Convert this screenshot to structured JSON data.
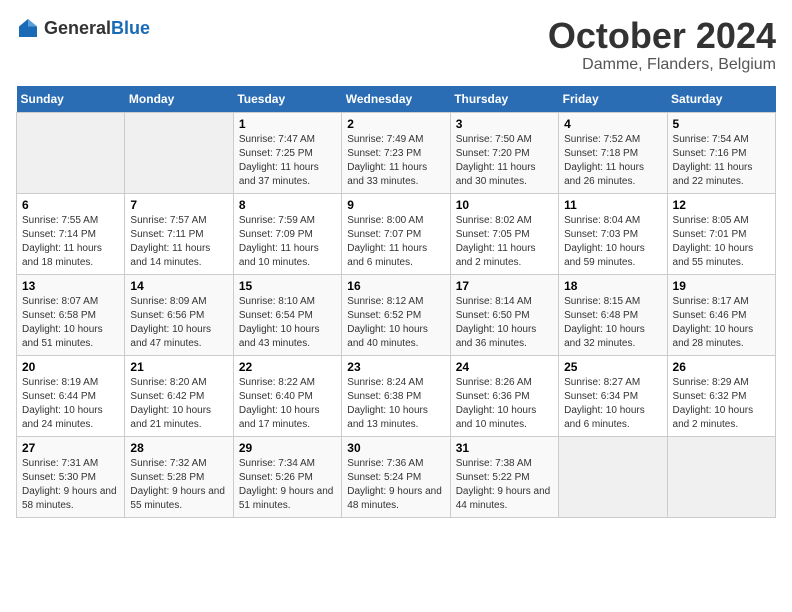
{
  "header": {
    "logo_general": "General",
    "logo_blue": "Blue",
    "title": "October 2024",
    "subtitle": "Damme, Flanders, Belgium"
  },
  "weekdays": [
    "Sunday",
    "Monday",
    "Tuesday",
    "Wednesday",
    "Thursday",
    "Friday",
    "Saturday"
  ],
  "weeks": [
    [
      {
        "day": "",
        "empty": true
      },
      {
        "day": "",
        "empty": true
      },
      {
        "day": "1",
        "sunrise": "7:47 AM",
        "sunset": "7:25 PM",
        "daylight": "11 hours and 37 minutes."
      },
      {
        "day": "2",
        "sunrise": "7:49 AM",
        "sunset": "7:23 PM",
        "daylight": "11 hours and 33 minutes."
      },
      {
        "day": "3",
        "sunrise": "7:50 AM",
        "sunset": "7:20 PM",
        "daylight": "11 hours and 30 minutes."
      },
      {
        "day": "4",
        "sunrise": "7:52 AM",
        "sunset": "7:18 PM",
        "daylight": "11 hours and 26 minutes."
      },
      {
        "day": "5",
        "sunrise": "7:54 AM",
        "sunset": "7:16 PM",
        "daylight": "11 hours and 22 minutes."
      }
    ],
    [
      {
        "day": "6",
        "sunrise": "7:55 AM",
        "sunset": "7:14 PM",
        "daylight": "11 hours and 18 minutes."
      },
      {
        "day": "7",
        "sunrise": "7:57 AM",
        "sunset": "7:11 PM",
        "daylight": "11 hours and 14 minutes."
      },
      {
        "day": "8",
        "sunrise": "7:59 AM",
        "sunset": "7:09 PM",
        "daylight": "11 hours and 10 minutes."
      },
      {
        "day": "9",
        "sunrise": "8:00 AM",
        "sunset": "7:07 PM",
        "daylight": "11 hours and 6 minutes."
      },
      {
        "day": "10",
        "sunrise": "8:02 AM",
        "sunset": "7:05 PM",
        "daylight": "11 hours and 2 minutes."
      },
      {
        "day": "11",
        "sunrise": "8:04 AM",
        "sunset": "7:03 PM",
        "daylight": "10 hours and 59 minutes."
      },
      {
        "day": "12",
        "sunrise": "8:05 AM",
        "sunset": "7:01 PM",
        "daylight": "10 hours and 55 minutes."
      }
    ],
    [
      {
        "day": "13",
        "sunrise": "8:07 AM",
        "sunset": "6:58 PM",
        "daylight": "10 hours and 51 minutes."
      },
      {
        "day": "14",
        "sunrise": "8:09 AM",
        "sunset": "6:56 PM",
        "daylight": "10 hours and 47 minutes."
      },
      {
        "day": "15",
        "sunrise": "8:10 AM",
        "sunset": "6:54 PM",
        "daylight": "10 hours and 43 minutes."
      },
      {
        "day": "16",
        "sunrise": "8:12 AM",
        "sunset": "6:52 PM",
        "daylight": "10 hours and 40 minutes."
      },
      {
        "day": "17",
        "sunrise": "8:14 AM",
        "sunset": "6:50 PM",
        "daylight": "10 hours and 36 minutes."
      },
      {
        "day": "18",
        "sunrise": "8:15 AM",
        "sunset": "6:48 PM",
        "daylight": "10 hours and 32 minutes."
      },
      {
        "day": "19",
        "sunrise": "8:17 AM",
        "sunset": "6:46 PM",
        "daylight": "10 hours and 28 minutes."
      }
    ],
    [
      {
        "day": "20",
        "sunrise": "8:19 AM",
        "sunset": "6:44 PM",
        "daylight": "10 hours and 24 minutes."
      },
      {
        "day": "21",
        "sunrise": "8:20 AM",
        "sunset": "6:42 PM",
        "daylight": "10 hours and 21 minutes."
      },
      {
        "day": "22",
        "sunrise": "8:22 AM",
        "sunset": "6:40 PM",
        "daylight": "10 hours and 17 minutes."
      },
      {
        "day": "23",
        "sunrise": "8:24 AM",
        "sunset": "6:38 PM",
        "daylight": "10 hours and 13 minutes."
      },
      {
        "day": "24",
        "sunrise": "8:26 AM",
        "sunset": "6:36 PM",
        "daylight": "10 hours and 10 minutes."
      },
      {
        "day": "25",
        "sunrise": "8:27 AM",
        "sunset": "6:34 PM",
        "daylight": "10 hours and 6 minutes."
      },
      {
        "day": "26",
        "sunrise": "8:29 AM",
        "sunset": "6:32 PM",
        "daylight": "10 hours and 2 minutes."
      }
    ],
    [
      {
        "day": "27",
        "sunrise": "7:31 AM",
        "sunset": "5:30 PM",
        "daylight": "9 hours and 58 minutes."
      },
      {
        "day": "28",
        "sunrise": "7:32 AM",
        "sunset": "5:28 PM",
        "daylight": "9 hours and 55 minutes."
      },
      {
        "day": "29",
        "sunrise": "7:34 AM",
        "sunset": "5:26 PM",
        "daylight": "9 hours and 51 minutes."
      },
      {
        "day": "30",
        "sunrise": "7:36 AM",
        "sunset": "5:24 PM",
        "daylight": "9 hours and 48 minutes."
      },
      {
        "day": "31",
        "sunrise": "7:38 AM",
        "sunset": "5:22 PM",
        "daylight": "9 hours and 44 minutes."
      },
      {
        "day": "",
        "empty": true
      },
      {
        "day": "",
        "empty": true
      }
    ]
  ],
  "labels": {
    "sunrise": "Sunrise:",
    "sunset": "Sunset:",
    "daylight": "Daylight:"
  }
}
